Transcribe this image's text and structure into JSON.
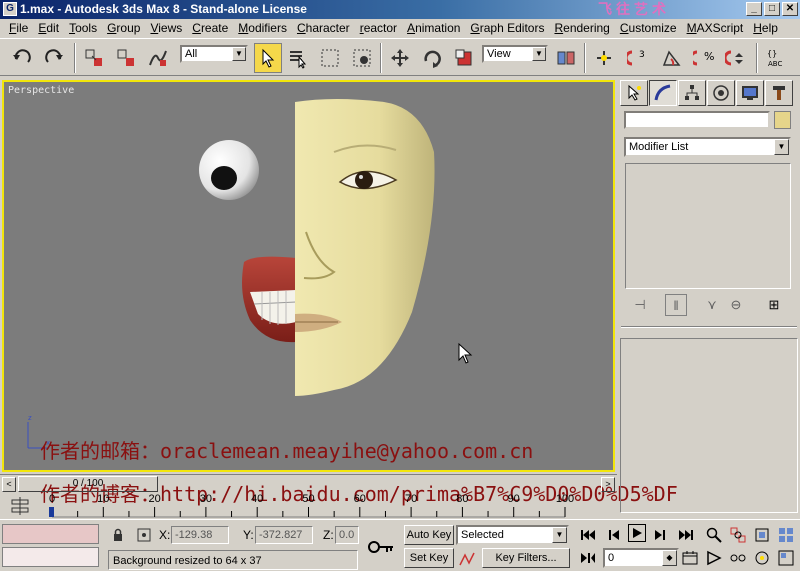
{
  "window": {
    "app_icon": "3ds-max-icon",
    "title": "1.max - Autodesk 3ds Max 8  - Stand-alone License",
    "deco_text": "飞往艺术",
    "buttons": [
      "_",
      "□",
      "✕"
    ]
  },
  "menu": [
    "File",
    "Edit",
    "Tools",
    "Group",
    "Views",
    "Create",
    "Modifiers",
    "Character",
    "reactor",
    "Animation",
    "Graph Editors",
    "Rendering",
    "Customize",
    "MAXScript",
    "Help"
  ],
  "toolbar": {
    "selection_filter": "All",
    "reference_coord": "View"
  },
  "viewport": {
    "label": "Perspective",
    "axis_x": "x",
    "axis_z": "z",
    "watermark_email": "作者的邮箱：oraclemean.meayihe@yahoo.com.cn",
    "watermark_blog": "作者的博客：http://hi.baidu.com/prima%B7%C9%D0%D0%D5%DF"
  },
  "command_panel": {
    "modifier_list": "Modifier List",
    "tabs": [
      "create-icon",
      "modify-icon",
      "hierarchy-icon",
      "motion-icon",
      "display-icon",
      "utilities-icon"
    ]
  },
  "timeline": {
    "frame_display": "0 / 100",
    "ticks": [
      0,
      10,
      20,
      30,
      40,
      50,
      60,
      70,
      80,
      90,
      100
    ],
    "current_frame": 0
  },
  "status": {
    "x_label": "X:",
    "x_value": "-129.38",
    "y_label": "Y:",
    "y_value": "-372.827",
    "z_label": "Z:",
    "z_value": "0.0",
    "prompt": "Background resized to 64 x 37",
    "auto_key": "Auto Key",
    "set_key": "Set Key",
    "key_mode": "Selected",
    "key_filters": "Key Filters...",
    "frame_field": "0"
  },
  "colors": {
    "viewport_bg": "#7c7c7c",
    "viewport_border": "#f2e60a",
    "watermark": "#8a1010",
    "face_skin": "#e8dea0"
  }
}
